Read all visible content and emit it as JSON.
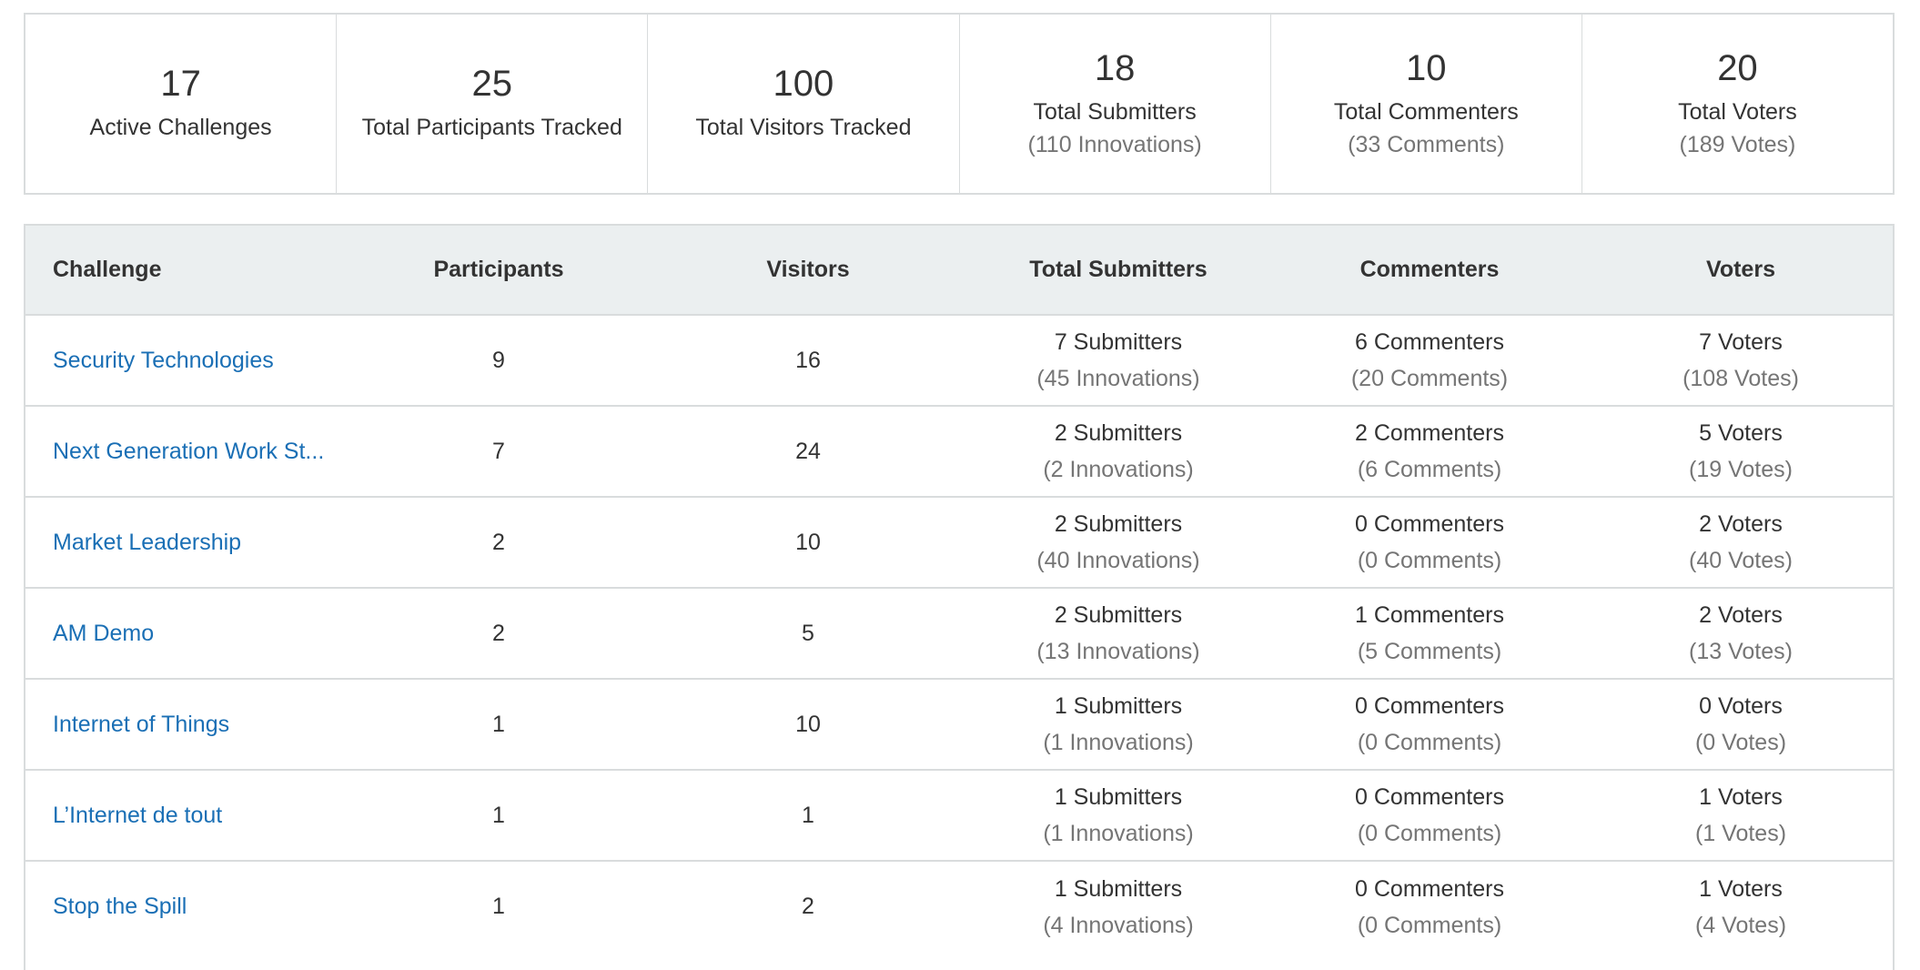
{
  "summary": [
    {
      "value": "17",
      "label": "Active Challenges",
      "sub": ""
    },
    {
      "value": "25",
      "label": "Total Participants Tracked",
      "sub": ""
    },
    {
      "value": "100",
      "label": "Total Visitors Tracked",
      "sub": ""
    },
    {
      "value": "18",
      "label": "Total Submitters",
      "sub": "(110 Innovations)"
    },
    {
      "value": "10",
      "label": "Total Commenters",
      "sub": "(33 Comments)"
    },
    {
      "value": "20",
      "label": "Total Voters",
      "sub": "(189 Votes)"
    }
  ],
  "table": {
    "headers": [
      "Challenge",
      "Participants",
      "Visitors",
      "Total Submitters",
      "Commenters",
      "Voters"
    ],
    "rows": [
      {
        "challenge": "Security Technologies",
        "participants": "9",
        "visitors": "16",
        "submitters": "7 Submitters",
        "innovations": "(45 Innovations)",
        "commenters": "6 Commenters",
        "comments": "(20 Comments)",
        "voters": "7 Voters",
        "votes": "(108 Votes)"
      },
      {
        "challenge": "Next Generation Work St...",
        "participants": "7",
        "visitors": "24",
        "submitters": "2 Submitters",
        "innovations": "(2 Innovations)",
        "commenters": "2 Commenters",
        "comments": "(6 Comments)",
        "voters": "5 Voters",
        "votes": "(19 Votes)"
      },
      {
        "challenge": "Market Leadership",
        "participants": "2",
        "visitors": "10",
        "submitters": "2 Submitters",
        "innovations": "(40 Innovations)",
        "commenters": "0 Commenters",
        "comments": "(0 Comments)",
        "voters": "2 Voters",
        "votes": "(40 Votes)"
      },
      {
        "challenge": "AM Demo",
        "participants": "2",
        "visitors": "5",
        "submitters": "2 Submitters",
        "innovations": "(13 Innovations)",
        "commenters": "1 Commenters",
        "comments": "(5 Comments)",
        "voters": "2 Voters",
        "votes": "(13 Votes)"
      },
      {
        "challenge": "Internet of Things",
        "participants": "1",
        "visitors": "10",
        "submitters": "1 Submitters",
        "innovations": "(1 Innovations)",
        "commenters": "0 Commenters",
        "comments": "(0 Comments)",
        "voters": "0 Voters",
        "votes": "(0 Votes)"
      },
      {
        "challenge": "L’Internet de tout",
        "participants": "1",
        "visitors": "1",
        "submitters": "1 Submitters",
        "innovations": "(1 Innovations)",
        "commenters": "0 Commenters",
        "comments": "(0 Comments)",
        "voters": "1 Voters",
        "votes": "(1 Votes)"
      },
      {
        "challenge": "Stop the Spill",
        "participants": "1",
        "visitors": "2",
        "submitters": "1 Submitters",
        "innovations": "(4 Innovations)",
        "commenters": "0 Commenters",
        "comments": "(0 Comments)",
        "voters": "1 Voters",
        "votes": "(4 Votes)"
      }
    ]
  },
  "colors": {
    "link": "#1a6fb5",
    "header_bg": "#ebeff0",
    "border": "#d9dcdd",
    "muted": "#757575"
  }
}
